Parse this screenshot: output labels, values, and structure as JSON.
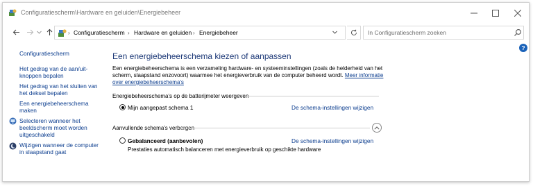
{
  "window": {
    "title": "Configuratiescherm\\Hardware en geluiden\\Energiebeheer"
  },
  "address": {
    "crumbs": [
      "Configuratiescherm",
      "Hardware en geluiden",
      "Energiebeheer"
    ]
  },
  "search": {
    "placeholder": "In Configuratiescherm zoeken"
  },
  "sidebar": {
    "home": "Configuratiescherm",
    "items": [
      {
        "label": "Het gedrag van de aan/uit-knoppen bepalen"
      },
      {
        "label": "Het gedrag van het sluiten van het deksel bepalen"
      },
      {
        "label": "Een energiebeheerschema maken"
      },
      {
        "label": "Selecteren wanneer het beeldscherm moet worden uitgeschakeld",
        "icon": "display-icon"
      },
      {
        "label": "Wijzigen wanneer de computer in slaapstand gaat",
        "icon": "moon-icon"
      }
    ]
  },
  "main": {
    "heading": "Een energiebeheerschema kiezen of aanpassen",
    "description": "Een energiebeheerschema is een verzameling hardware- en systeeminstellingen (zoals de helderheid van het scherm, slaapstand enzovoort) waarmee het energieverbruik van de computer beheerd wordt.",
    "more_link": "Meer informatie over energiebeheerschema's",
    "battery_section": "Energiebeheerschema's op de batterijmeter weergeven",
    "hidden_section": "Aanvullende schema's verbergen",
    "plans": [
      {
        "name": "Mijn aangepast schema 1",
        "link": "De schema-instellingen wijzigen",
        "selected": true
      },
      {
        "name": "Gebalanceerd (aanbevolen)",
        "link": "De schema-instellingen wijzigen",
        "selected": false,
        "description": "Prestaties automatisch balanceren met energieverbruik op geschikte hardware"
      }
    ]
  },
  "colors": {
    "link": "#0a3c8e",
    "heading": "#1e3a78",
    "help": "#1a62b9"
  }
}
